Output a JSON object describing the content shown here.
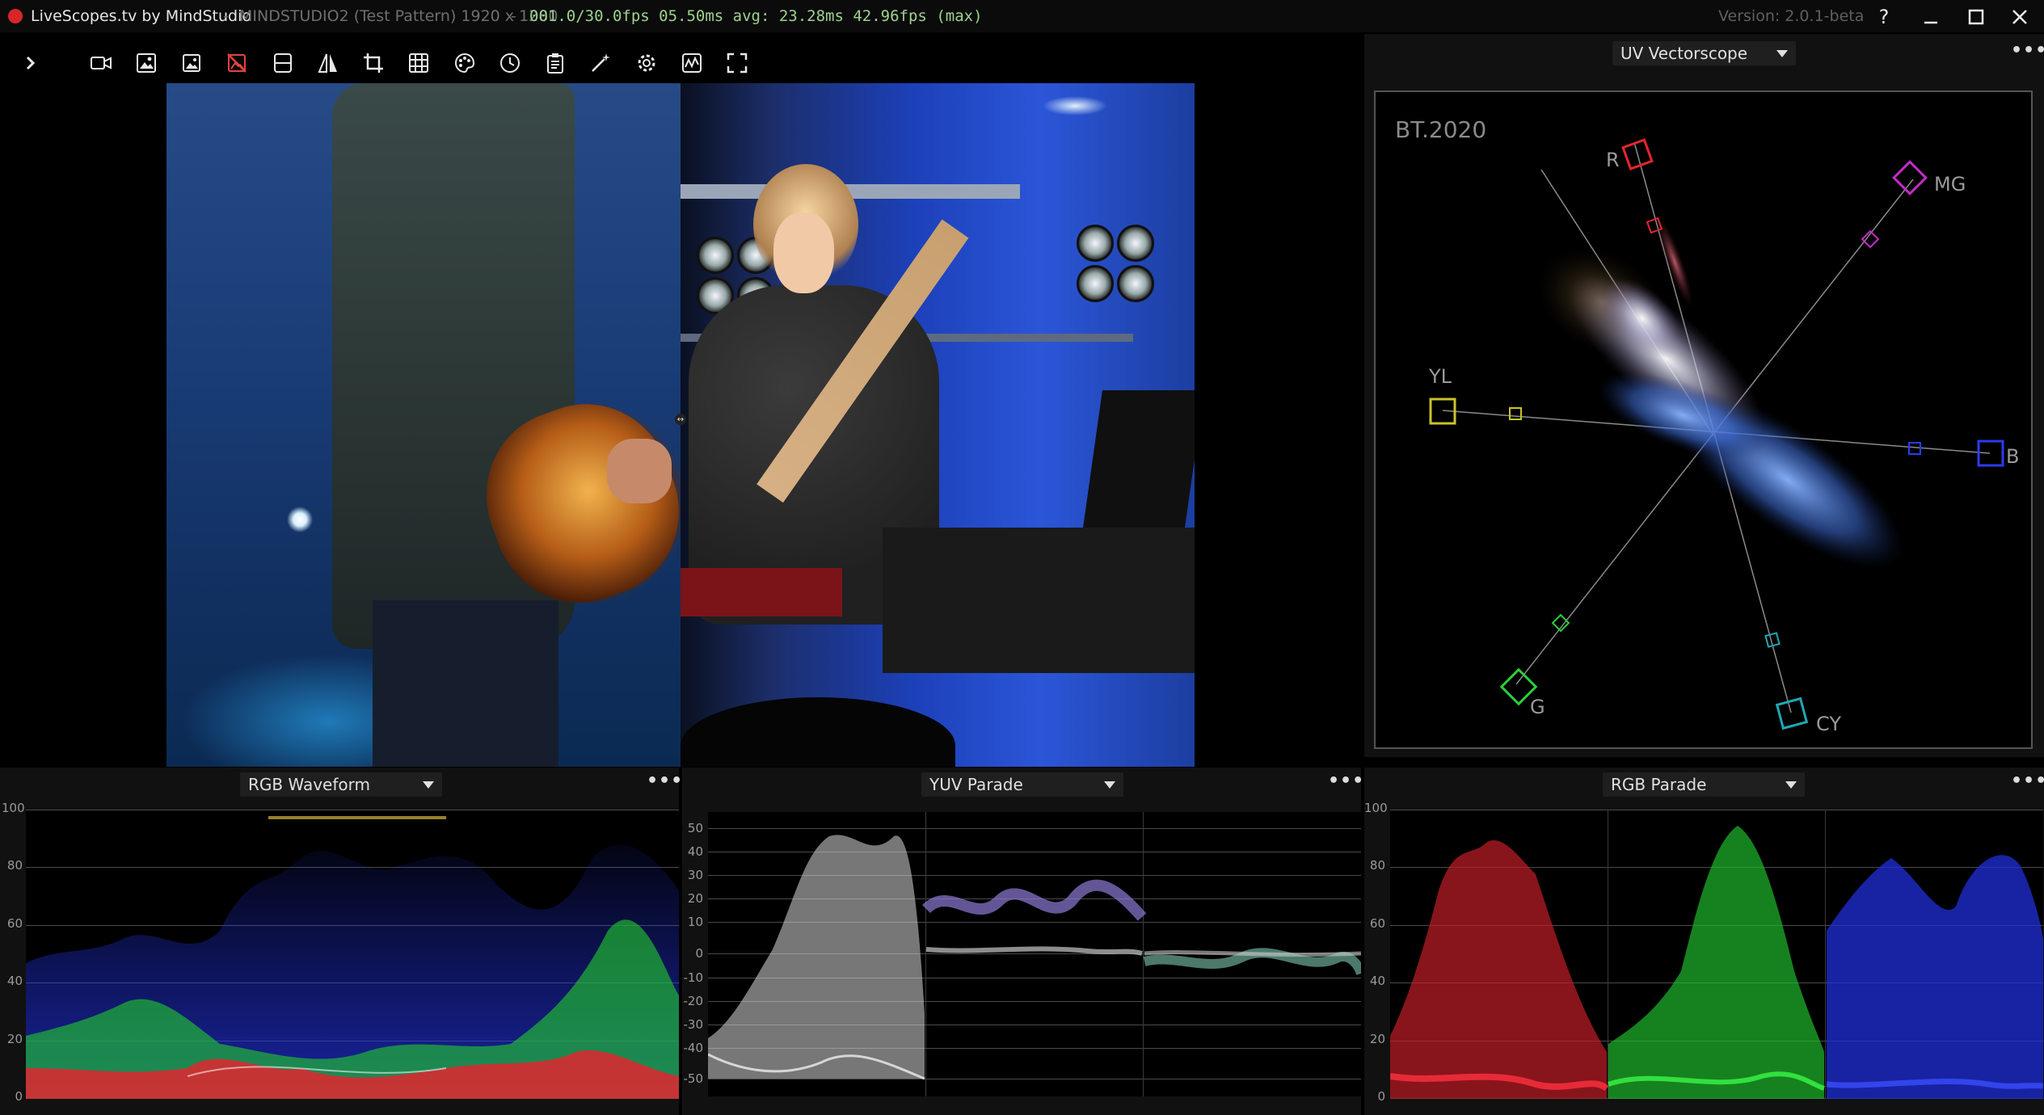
{
  "titlebar": {
    "app_name": "LiveScopes.tv by MindStudio",
    "separator": "-",
    "source": "MINDSTUDIO2 (Test Pattern) 1920 x 1280",
    "stats": "001.0/30.0fps 05.50ms avg: 23.28ms 42.96fps (max)",
    "version": "Version: 2.0.1-beta",
    "help": "?",
    "minimize": "—",
    "maximize": "□",
    "close": "✕"
  },
  "toolbar": {
    "expand": "›",
    "tools": [
      "camera-icon",
      "image-compare-icon",
      "image-icon",
      "image-off-icon",
      "split-horizontal-icon",
      "flip-icon",
      "crop-icon",
      "grid-icon",
      "color-palette-icon",
      "clock-icon",
      "clipboard-icon",
      "magic-wand-icon",
      "settings-gear-icon",
      "waveform-settings-icon",
      "fullscreen-icon"
    ],
    "active_tool": "image-off-icon",
    "active_color": "#e0463f"
  },
  "vectorscope": {
    "selector": "UV Vectorscope",
    "more": "•••",
    "standard": "BT.2020",
    "targets": {
      "R": "R",
      "MG": "MG",
      "YL": "YL",
      "B": "B",
      "G": "G",
      "CY": "CY"
    }
  },
  "waveform_rgb": {
    "selector": "RGB Waveform",
    "more": "•••",
    "scale": [
      "100",
      "80",
      "60",
      "40",
      "20",
      "0"
    ]
  },
  "yuv_parade": {
    "selector": "YUV Parade",
    "more": "•••",
    "scale": [
      "50",
      "40",
      "30",
      "20",
      "10",
      "0",
      "-10",
      "-20",
      "-30",
      "-40",
      "-50"
    ]
  },
  "rgb_parade": {
    "selector": "RGB Parade",
    "more": "•••",
    "scale": [
      "100",
      "80",
      "60",
      "40",
      "20",
      "0"
    ]
  },
  "colors": {
    "background": "#000000",
    "panel": "#111111",
    "red": "#e3262f",
    "green": "#2ccf3a",
    "blue": "#2a3cf0",
    "magenta": "#c42bc9",
    "yellow": "#c9c32a",
    "cyan": "#1fa8b5",
    "stats": "#9ed28f"
  }
}
